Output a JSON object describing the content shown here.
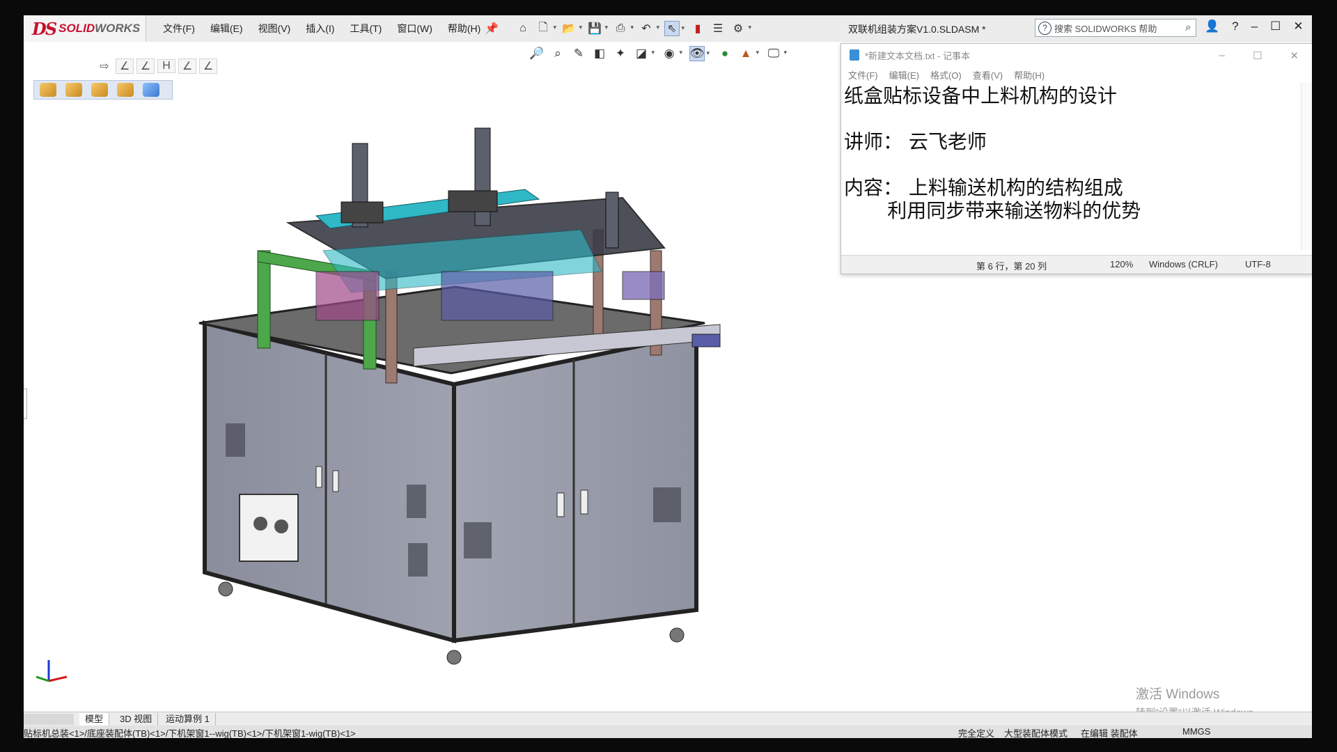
{
  "app": {
    "logo_mark": "DS",
    "logo_solid": "SOLID",
    "logo_works": "WORKS",
    "document_title": "双联机组装方案V1.0.SLDASM *",
    "search_placeholder": "搜索 SOLIDWORKS 帮助"
  },
  "menu": [
    "文件(F)",
    "编辑(E)",
    "视图(V)",
    "插入(I)",
    "工具(T)",
    "窗口(W)",
    "帮助(H)"
  ],
  "toolbar_icons": [
    "home-icon",
    "new-document-icon",
    "open-icon",
    "save-icon",
    "print-icon",
    "undo-icon",
    "select-icon",
    "rebuild-icon",
    "file-properties-icon",
    "options-icon"
  ],
  "notepad": {
    "title": "*新建文本文档.txt - 记事本",
    "menu": [
      "文件(F)",
      "编辑(E)",
      "格式(O)",
      "查看(V)",
      "帮助(H)"
    ],
    "lines": [
      "纸盒贴标设备中上料机构的设计",
      "",
      "讲师： 云飞老师",
      "",
      "内容： 上料输送机构的结构组成",
      "       利用同步带来输送物料的优势"
    ],
    "status": {
      "position": "第 6 行，第 20 列",
      "zoom": "120%",
      "line_ending": "Windows (CRLF)",
      "encoding": "UTF-8"
    }
  },
  "watermark": {
    "line1": "激活 Windows",
    "line2": "转到\"设置\"以激活 Windows。"
  },
  "tabs": [
    "模型",
    "3D 视图",
    "运动算例 1"
  ],
  "statusbar": {
    "breadcrumb": "贴标机总装<1>/底座装配体(TB)<1>/下机架窗1--wig(TB)<1>/下机架窗1-wig(TB)<1>",
    "state1": "完全定义",
    "state2": "大型装配体模式",
    "state3": "在编辑 装配体",
    "units": "MMGS"
  },
  "colors": {
    "brand": "#c8102e",
    "frame_green": "#4ca84a",
    "cabinet_gray": "#9598a6",
    "cyan_part": "#2fb8c6",
    "brown_post": "#9c7a72"
  }
}
